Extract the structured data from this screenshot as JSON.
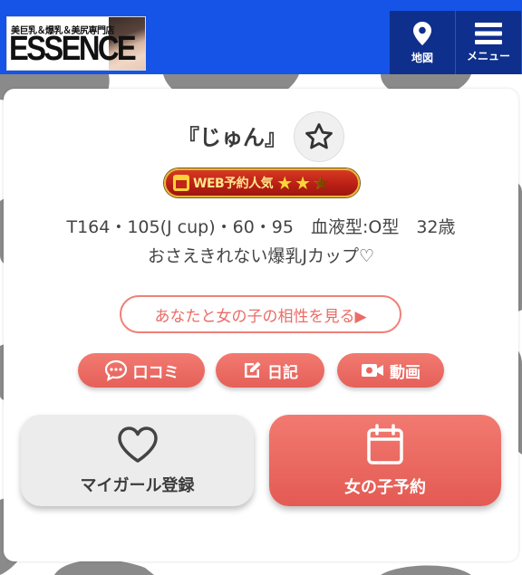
{
  "header": {
    "logo": {
      "tagline": "美巨乳＆爆乳＆美尻専門店",
      "brand": "ESSENCE"
    },
    "map_label": "地図",
    "menu_label": "メニュー"
  },
  "profile": {
    "name": "『じゅん』",
    "badge_text": "WEB予約人気",
    "badge_rating": 2.5,
    "stats": "T164・105(J cup)・60・95　血液型:O型　32歳",
    "catchphrase": "おさえきれない爆乳Jカップ♡",
    "compat_button": "あなたと女の子の相性を見る▶"
  },
  "links": {
    "review": "口コミ",
    "diary": "日記",
    "video": "動画"
  },
  "actions": {
    "mygirl": "マイガール登録",
    "reserve": "女の子予約"
  },
  "colors": {
    "header_blue": "#1554e6",
    "nav_navy": "#0f2f8c",
    "accent_coral": "#ea6c65",
    "cow_spot": "#808080"
  },
  "icons": {
    "map": "map-pin-icon",
    "menu": "hamburger-menu-icon",
    "favorite": "star-outline-icon",
    "review": "chat-bubble-icon",
    "diary": "edit-note-icon",
    "video": "video-camera-icon",
    "mygirl": "heart-outline-icon",
    "reserve": "calendar-icon"
  }
}
